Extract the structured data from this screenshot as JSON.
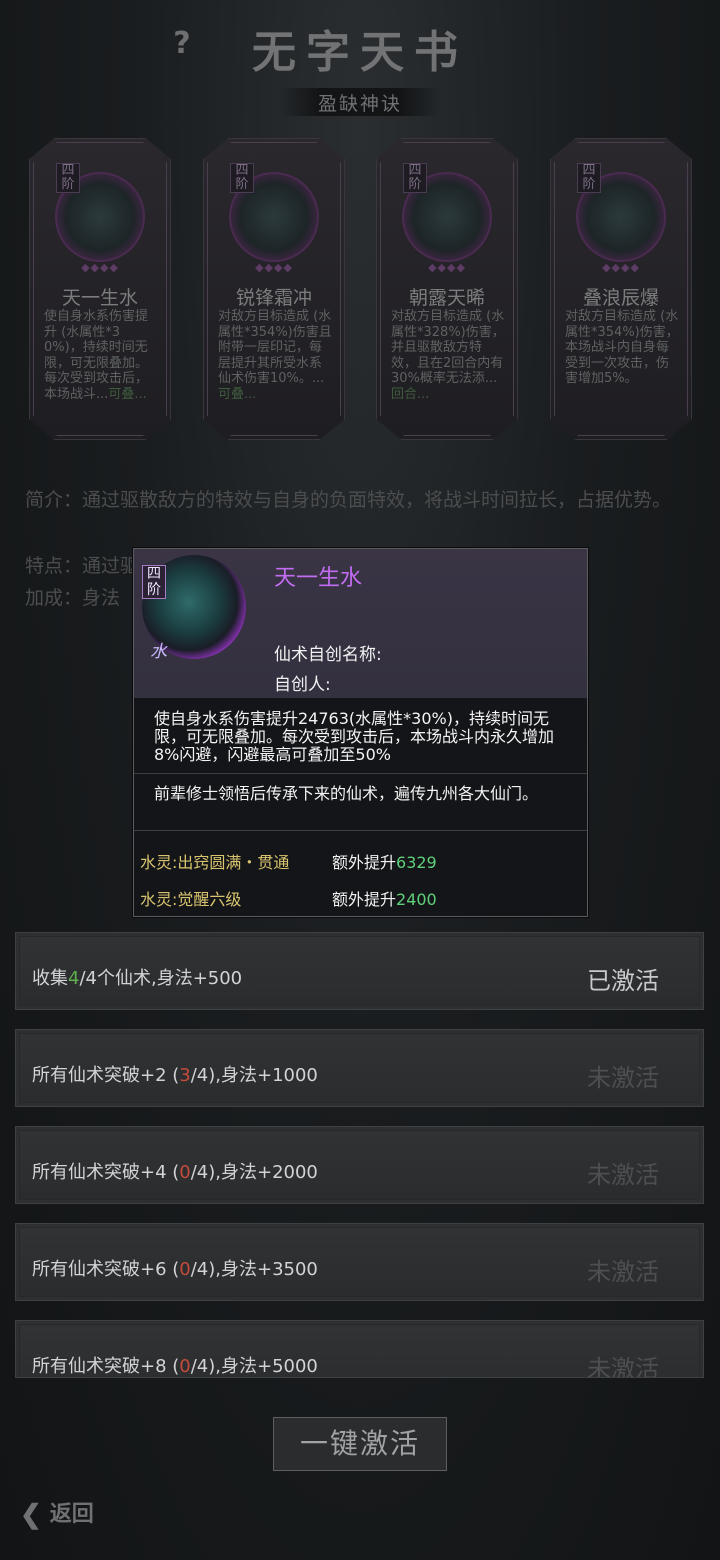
{
  "header": {
    "help_icon": "?",
    "title": "无字天书",
    "subtitle": "盈缺神诀"
  },
  "cards": [
    {
      "tier": "四阶",
      "name": "天一生水",
      "desc": "使自身水系伤害提升          (水属性*30%)，持续时间无限，可无限叠加。每次受到攻击后，本场战斗...",
      "tail": "可叠..."
    },
    {
      "tier": "四阶",
      "name": "锐锋霜冲",
      "desc": "对敌方目标造成          (水属性*354%)伤害且附带一层印记，每层提升其所受水系仙术伤害10%。...",
      "tail": "可叠..."
    },
    {
      "tier": "四阶",
      "name": "朝露天晞",
      "desc": "对敌方目标造成          (水属性*328%)伤害，并且驱散敌方特效，且在2回合内有30%概率无法添...",
      "tail": "回合..."
    },
    {
      "tier": "四阶",
      "name": "叠浪辰爆",
      "desc": "对敌方目标造成          (水属性*354%)伤害，本场战斗内自身每受到一次攻击，伤害增加5%。",
      "tail": ""
    }
  ],
  "info": {
    "intro": "简介：通过驱散敌方的特效与自身的负面特效，将战斗时间拉长，占据优势。",
    "feature": "特点：通过驱散自身负面状态并增加自己造成的伤害。",
    "bonus": "加成：身法（命中概率）"
  },
  "popup": {
    "tier": "四阶",
    "element": "水",
    "name": "天一生水",
    "custom_name_label": "仙术自创名称:",
    "creator_label": "自创人:",
    "effect": "使自身水系伤害提升24763(水属性*30%)，持续时间无限，可无限叠加。每次受到攻击后，本场战斗内永久增加8%闪避，闪避最高可叠加至50%",
    "lore": "前辈修士领悟后传承下来的仙术，遍传九州各大仙门。",
    "bonuses": [
      {
        "source": "水灵:出窍圆满・贯通",
        "label": "额外提升",
        "value": "6329"
      },
      {
        "source": "水灵:觉醒六级",
        "label": "额外提升",
        "value": "2400"
      }
    ]
  },
  "sets": [
    {
      "pre": "收集",
      "count": "4",
      "post": "/4个仙术,身法+500",
      "status": "已激活",
      "active": true
    },
    {
      "pre": "所有仙术突破+2 (",
      "count": "3",
      "post": "/4),身法+1000",
      "status": "未激活",
      "active": false
    },
    {
      "pre": "所有仙术突破+4 (",
      "count": "0",
      "post": "/4),身法+2000",
      "status": "未激活",
      "active": false
    },
    {
      "pre": "所有仙术突破+6 (",
      "count": "0",
      "post": "/4),身法+3500",
      "status": "未激活",
      "active": false
    },
    {
      "pre": "所有仙术突破+8 (",
      "count": "0",
      "post": "/4),身法+5000",
      "status": "未激活",
      "active": false
    }
  ],
  "actions": {
    "activate_all": "一键激活",
    "back": "返回"
  },
  "colors": {
    "popup_name": "#c26cf2",
    "bonus_source": "#d8c46e",
    "bonus_value": "#5fd07a",
    "count_green": "#5fb04f",
    "count_red": "#c44b3b"
  }
}
